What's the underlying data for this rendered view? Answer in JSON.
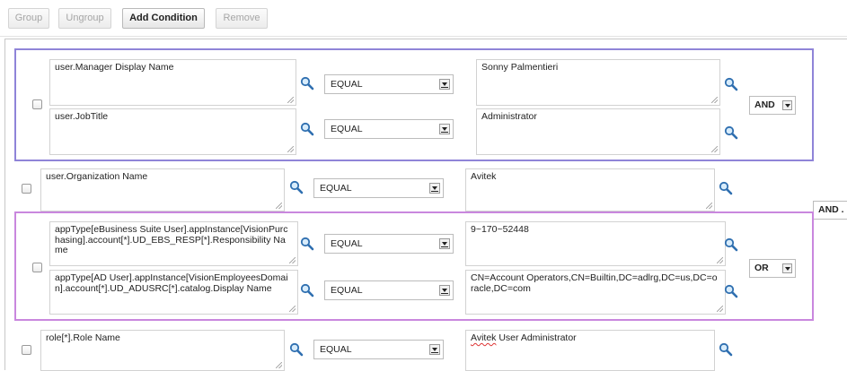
{
  "toolbar": {
    "group": "Group",
    "ungroup": "Ungroup",
    "add_condition": "Add Condition",
    "remove": "Remove"
  },
  "icons": {
    "search": "magnifier-icon",
    "dropdown": "chevron-down-icon",
    "resize": "resize-grip-icon"
  },
  "colors": {
    "and_group_border": "#8f84d8",
    "or_group_border": "#c987de",
    "search_icon": "#2f6fb0"
  },
  "groups": {
    "and_group": {
      "operator": "AND",
      "rows": [
        {
          "attribute": "user.Manager Display Name",
          "comparison": "EQUAL",
          "value": "Sonny Palmentieri"
        },
        {
          "attribute": "user.JobTitle",
          "comparison": "EQUAL",
          "value": "Administrator"
        }
      ]
    },
    "single_1": {
      "attribute": "user.Organization Name",
      "comparison": "EQUAL",
      "value": "Avitek"
    },
    "or_group": {
      "operator": "OR",
      "rows": [
        {
          "attribute": "appType[eBusiness Suite User].appInstance[VisionPurchasing].account[*].UD_EBS_RESP[*].Responsibility Name",
          "comparison": "EQUAL",
          "value": "9~170~52448"
        },
        {
          "attribute": "appType[AD User].appInstance[VisionEmployeesDomain].account[*].UD_ADUSRC[*].catalog.Display Name",
          "comparison": "EQUAL",
          "value": "CN=Account Operators,CN=Builtin,DC=adlrg,DC=us,DC=oracle,DC=com"
        }
      ]
    },
    "single_2": {
      "attribute": "role[*].Role Name",
      "comparison": "EQUAL",
      "value_word1": "Avitek",
      "value_rest": " User Administrator"
    }
  },
  "top_operator": "AND ."
}
